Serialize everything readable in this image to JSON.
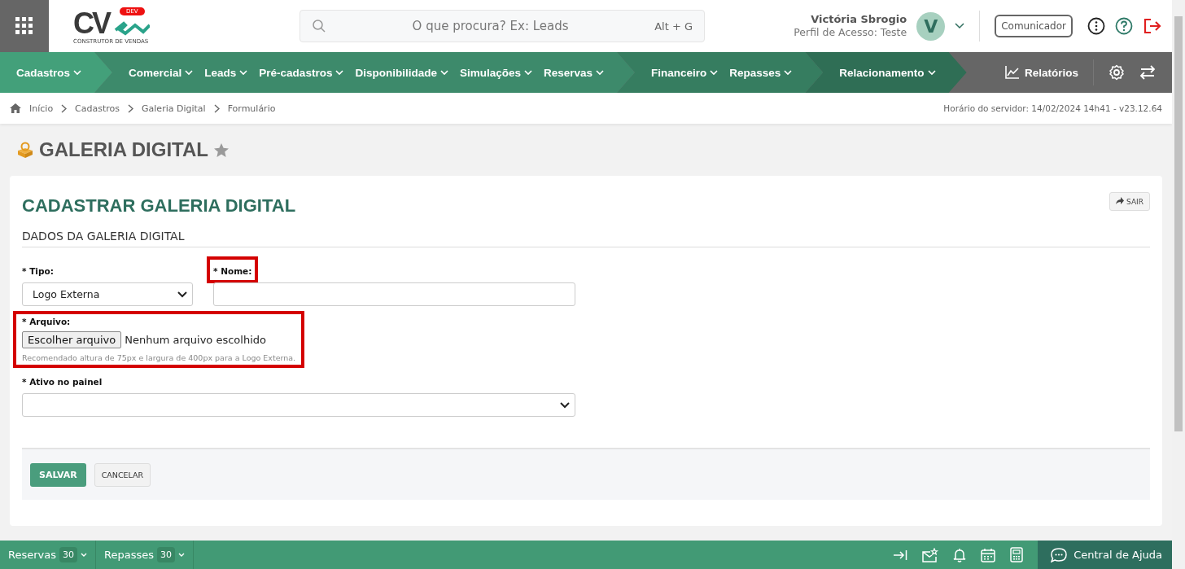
{
  "header": {
    "logo": {
      "letters": "CV",
      "badge": "DEV",
      "tagline": "CONSTRUTOR DE VENDAS"
    },
    "search": {
      "placeholder": "O que procura? Ex: Leads",
      "shortcut": "Alt + G"
    },
    "user": {
      "name": "Victória Sbrogio",
      "profile": "Perfil de Acesso: Teste",
      "initial": "V"
    },
    "communicator_button": "Comunicador"
  },
  "nav": {
    "groups": [
      {
        "color": "#43a07a",
        "items": [
          "Cadastros"
        ]
      },
      {
        "color": "#3d8a6b",
        "items": [
          "Comercial",
          "Leads",
          "Pré-cadastros",
          "Disponibilidade",
          "Simulações",
          "Reservas"
        ]
      },
      {
        "color": "#367d60",
        "items": [
          "Financeiro",
          "Repasses"
        ]
      },
      {
        "color": "#2f6e55",
        "items": [
          "Relacionamento"
        ]
      }
    ],
    "reports": "Relatórios"
  },
  "breadcrumb": [
    "Início",
    "Cadastros",
    "Galeria Digital",
    "Formulário"
  ],
  "server_info": "Horário do servidor: 14/02/2024 14h41 - v23.12.64",
  "page_title": "GALERIA DIGITAL",
  "favorite": false,
  "form": {
    "title": "CADASTRAR GALERIA DIGITAL",
    "exit_button": "SAIR",
    "section": "DADOS DA GALERIA DIGITAL",
    "fields": [
      {
        "kind": "select",
        "label": "* Tipo:",
        "value": "Logo Externa",
        "highlighted": false
      },
      {
        "kind": "text",
        "label": "* Nome:",
        "highlighted": true
      },
      {
        "kind": "file",
        "label": "* Arquivo:",
        "button": "Escolher arquivo",
        "status": "Nenhum arquivo escolhido",
        "hint": "Recomendado altura de 75px e largura de 400px para a Logo Externa.",
        "highlighted": true
      },
      {
        "kind": "select",
        "label": "* Ativo no painel",
        "highlighted": false
      }
    ],
    "save_button": "SALVAR",
    "cancel_button": "CANCELAR"
  },
  "footer": {
    "tabs": [
      {
        "label": "Reservas",
        "count": "30"
      },
      {
        "label": "Repasses",
        "count": "30"
      }
    ],
    "help": "Central de Ajuda"
  }
}
